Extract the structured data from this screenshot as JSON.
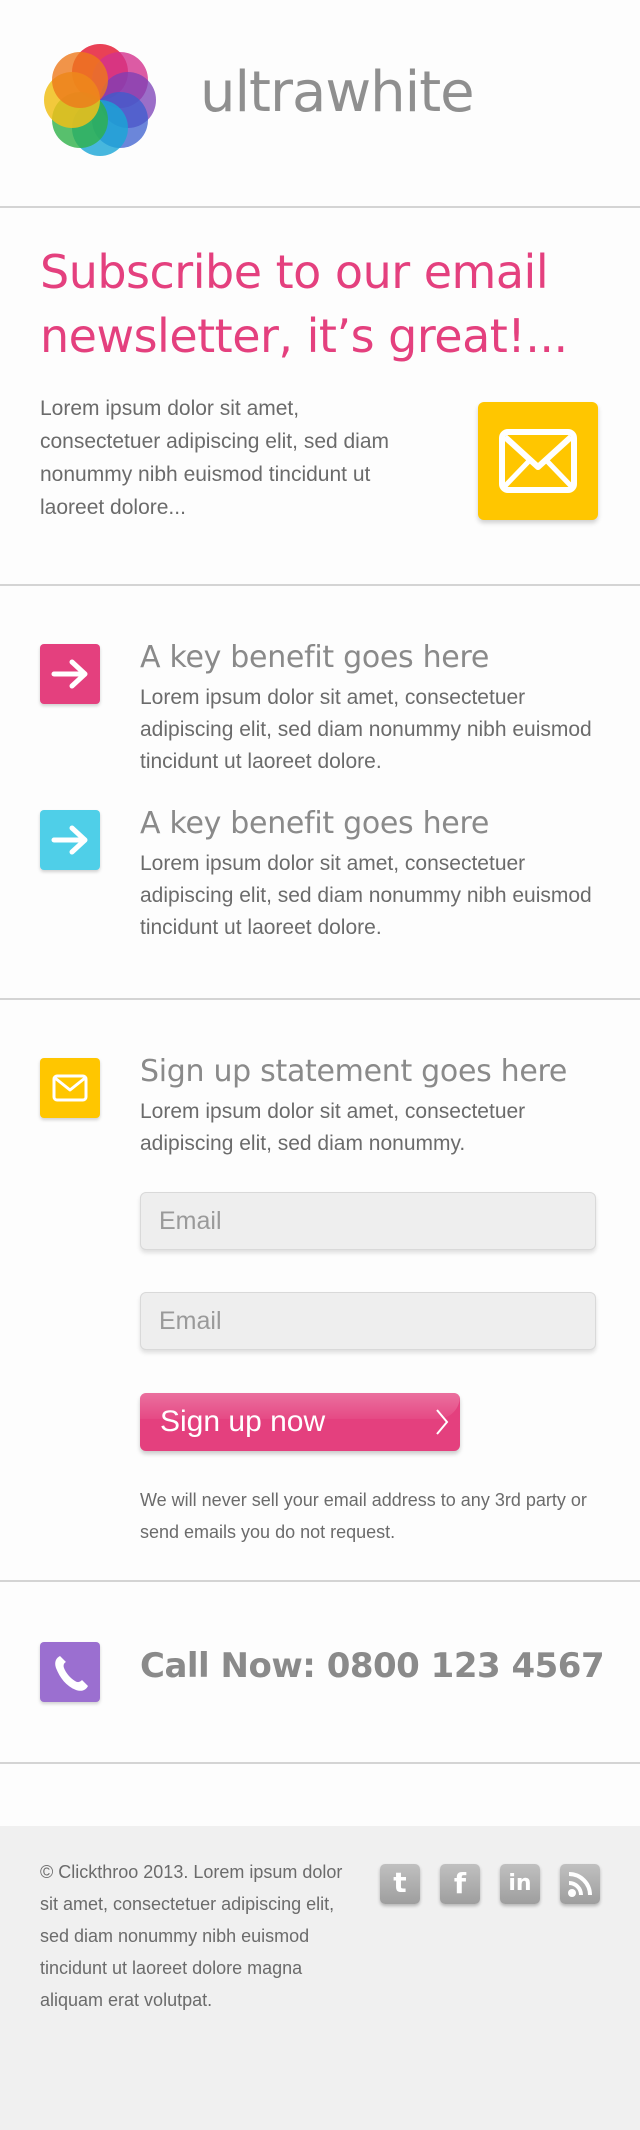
{
  "header": {
    "brand": "ultrawhite"
  },
  "hero": {
    "headline": "Subscribe to our email newsletter, it’s great!...",
    "text": "Lorem ipsum dolor sit amet, consectetuer adipiscing elit, sed diam nonummy nibh euismod tincidunt ut laoreet dolore..."
  },
  "benefits": [
    {
      "title": "A key benefit goes here",
      "text": "Lorem ipsum dolor sit amet, consectetuer adipiscing elit, sed diam nonummy nibh euismod tincidunt ut laoreet dolore.",
      "icon": "arrow-right-icon",
      "color": "#e4407e"
    },
    {
      "title": "A key benefit goes here",
      "text": "Lorem ipsum dolor sit amet, consectetuer adipiscing elit, sed diam nonummy nibh euismod tincidunt ut laoreet dolore.",
      "icon": "arrow-right-icon",
      "color": "#4fcfe8"
    }
  ],
  "signup": {
    "title": "Sign up statement goes here",
    "text": "Lorem ipsum dolor sit amet, consectetuer adipiscing elit, sed diam nonummy.",
    "icon": "envelope-icon",
    "icon_color": "#ffc600",
    "fields": [
      {
        "placeholder": "Email",
        "value": ""
      },
      {
        "placeholder": "Email",
        "value": ""
      }
    ],
    "button_label": "Sign up now",
    "disclaimer": "We will never sell your email address to any 3rd party or send emails you do not request."
  },
  "call": {
    "text": "Call Now: 0800 123 4567",
    "icon": "phone-icon",
    "icon_color": "#9b6fd0"
  },
  "footer": {
    "text": "© Clickthroo 2013. Lorem ipsum dolor sit amet, consectetuer adipiscing elit, sed diam nonummy nibh euismod tincidunt ut laoreet dolore magna aliquam erat volutpat.",
    "social": [
      {
        "name": "twitter-icon",
        "glyph": "t"
      },
      {
        "name": "facebook-icon",
        "glyph": "f"
      },
      {
        "name": "linkedin-icon",
        "glyph": "in"
      },
      {
        "name": "rss-icon",
        "glyph": ""
      }
    ]
  },
  "colors": {
    "accent": "#e4407e",
    "yellow": "#ffc600",
    "cyan": "#4fcfe8",
    "purple": "#9b6fd0",
    "gray_text": "#8a8a8a"
  }
}
